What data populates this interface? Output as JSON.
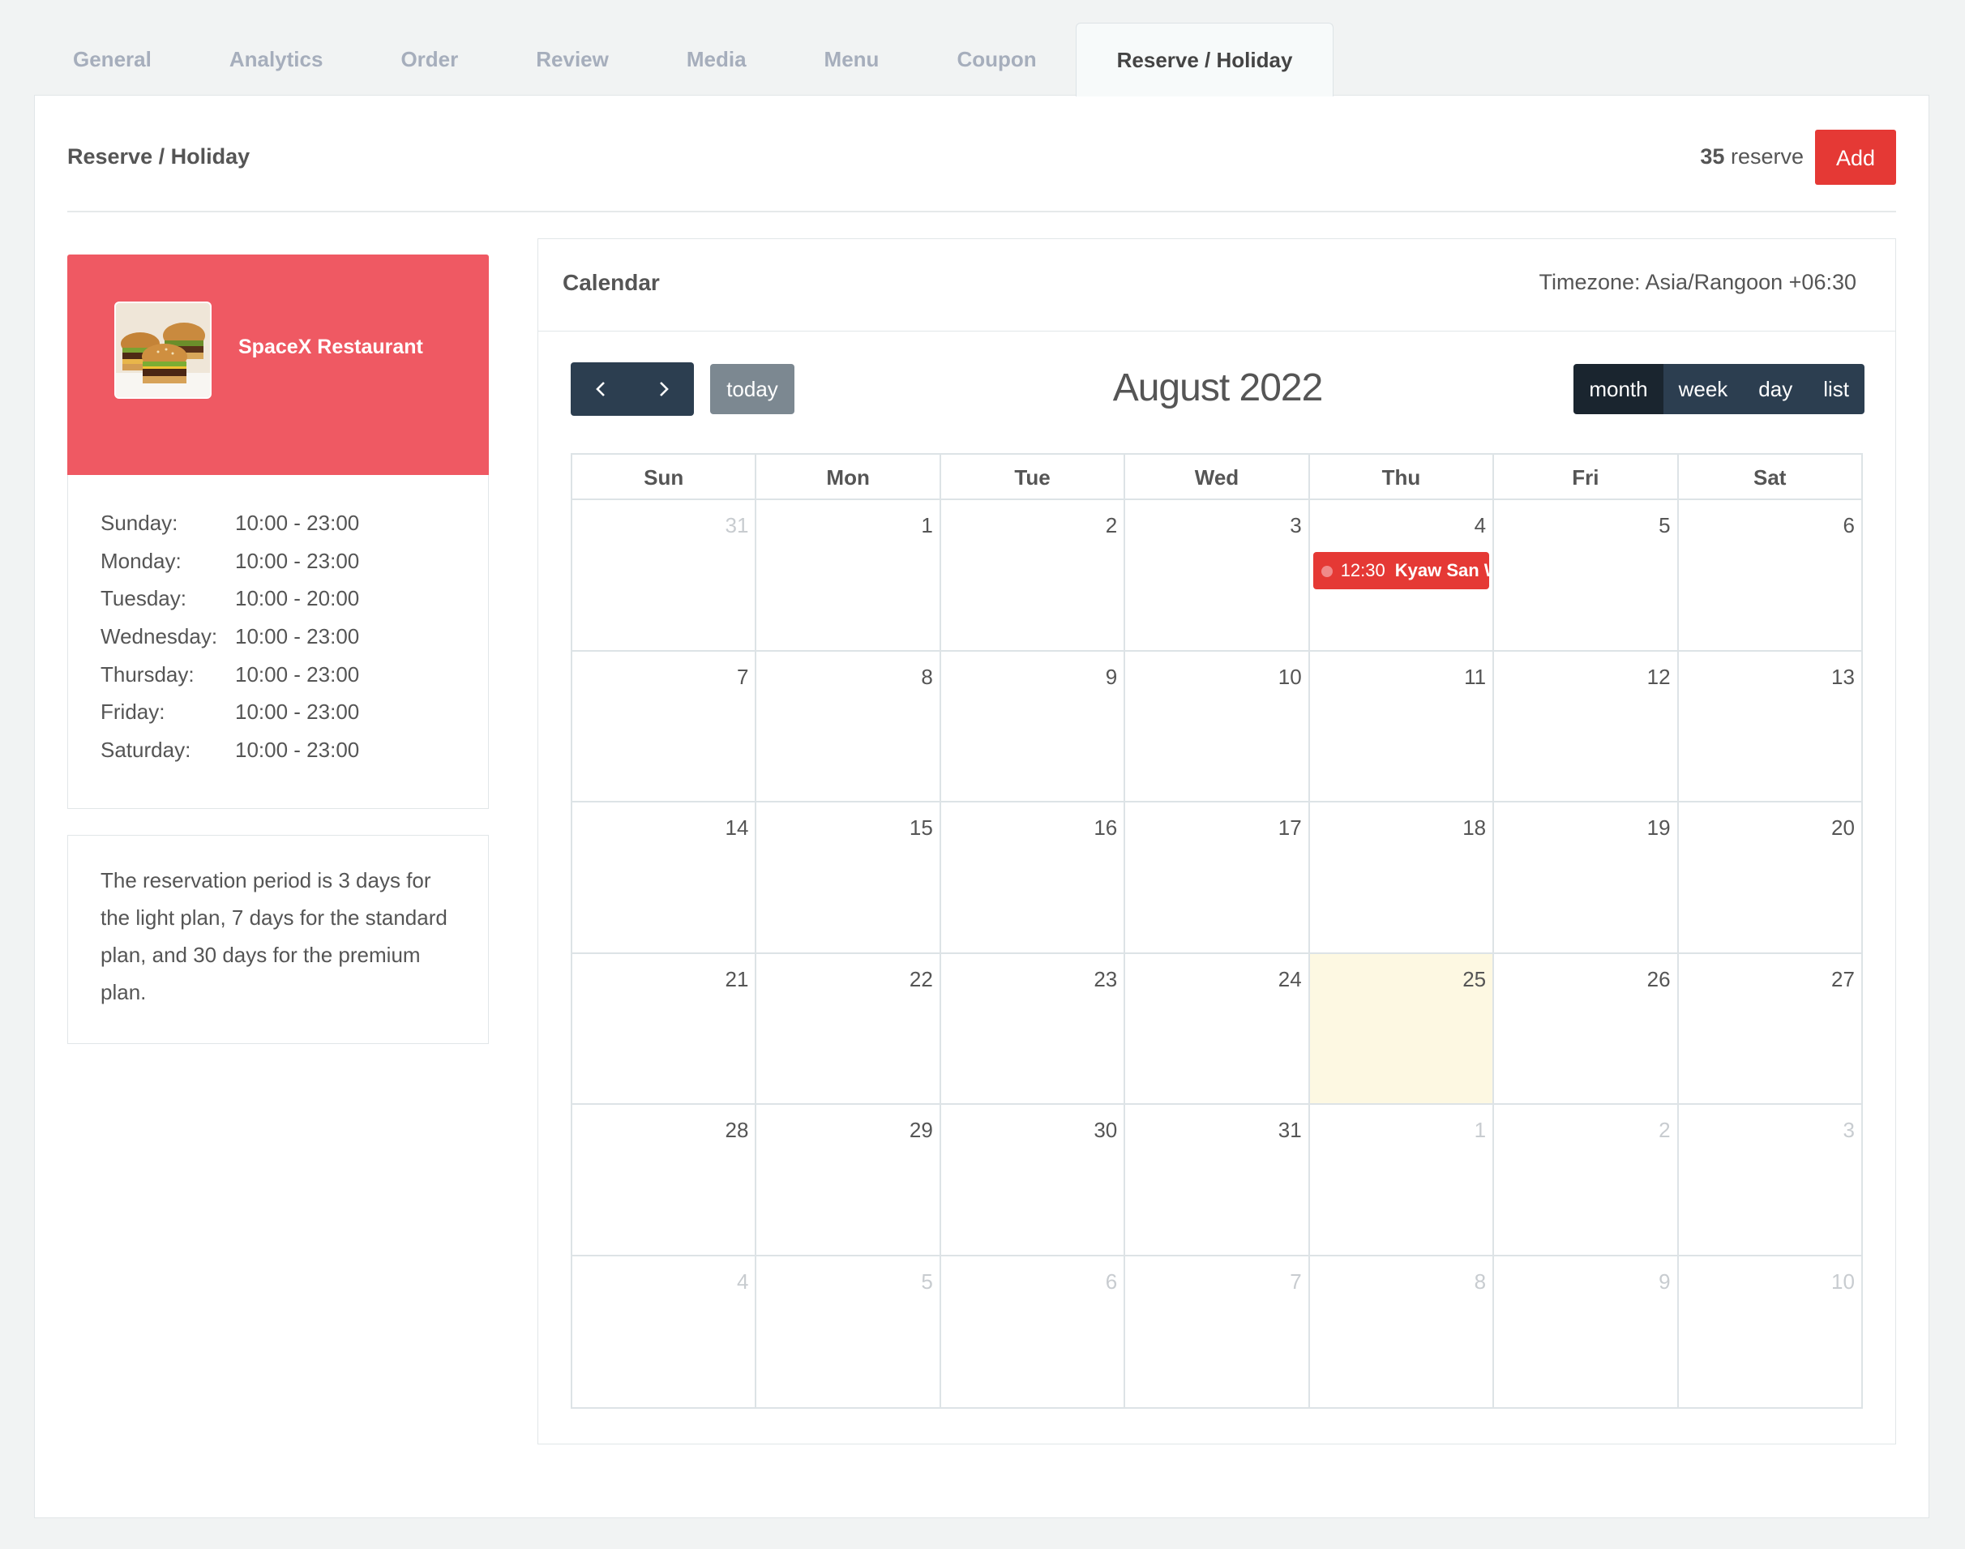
{
  "tabs": [
    "General",
    "Analytics",
    "Order",
    "Review",
    "Media",
    "Menu",
    "Coupon",
    "Reserve / Holiday"
  ],
  "active_tab": "Reserve / Holiday",
  "header": {
    "title": "Reserve / Holiday",
    "reserve_count": "35",
    "reserve_label": " reserve",
    "add_label": "Add"
  },
  "restaurant": {
    "name": "SpaceX Restaurant",
    "hours": [
      {
        "day": "Sunday:",
        "time": "10:00 - 23:00"
      },
      {
        "day": "Monday:",
        "time": "10:00 - 23:00"
      },
      {
        "day": "Tuesday:",
        "time": "10:00 - 20:00"
      },
      {
        "day": "Wednesday:",
        "time": "10:00 - 23:00"
      },
      {
        "day": "Thursday:",
        "time": "10:00 - 23:00"
      },
      {
        "day": "Friday:",
        "time": "10:00 - 23:00"
      },
      {
        "day": "Saturday:",
        "time": "10:00 - 23:00"
      }
    ],
    "note": "The reservation period is 3 days for the light plan, 7 days for the standard plan, and 30 days for the premium plan."
  },
  "calendar": {
    "title": "Calendar",
    "timezone": "Timezone: Asia/Rangoon +06:30",
    "month_title": "August 2022",
    "today_label": "today",
    "views": [
      "month",
      "week",
      "day",
      "list"
    ],
    "active_view": "month",
    "weekdays": [
      "Sun",
      "Mon",
      "Tue",
      "Wed",
      "Thu",
      "Fri",
      "Sat"
    ],
    "weeks": [
      [
        "31",
        "1",
        "2",
        "3",
        "4",
        "5",
        "6"
      ],
      [
        "7",
        "8",
        "9",
        "10",
        "11",
        "12",
        "13"
      ],
      [
        "14",
        "15",
        "16",
        "17",
        "18",
        "19",
        "20"
      ],
      [
        "21",
        "22",
        "23",
        "24",
        "25",
        "26",
        "27"
      ],
      [
        "28",
        "29",
        "30",
        "31",
        "1",
        "2",
        "3"
      ],
      [
        "4",
        "5",
        "6",
        "7",
        "8",
        "9",
        "10"
      ]
    ],
    "other_month": [
      [
        0,
        0
      ],
      [
        4,
        4
      ],
      [
        4,
        5
      ],
      [
        4,
        6
      ],
      [
        5,
        0
      ],
      [
        5,
        1
      ],
      [
        5,
        2
      ],
      [
        5,
        3
      ],
      [
        5,
        4
      ],
      [
        5,
        5
      ],
      [
        5,
        6
      ]
    ],
    "today_cell": [
      3,
      4
    ],
    "events": [
      {
        "week": 0,
        "day": 4,
        "time": "12:30",
        "title": "Kyaw San Win"
      }
    ]
  },
  "colors": {
    "accent_red": "#e53935",
    "card_red": "#ef5963",
    "nav_dark": "#2c3e50",
    "today_bg": "#fdf8e2"
  }
}
